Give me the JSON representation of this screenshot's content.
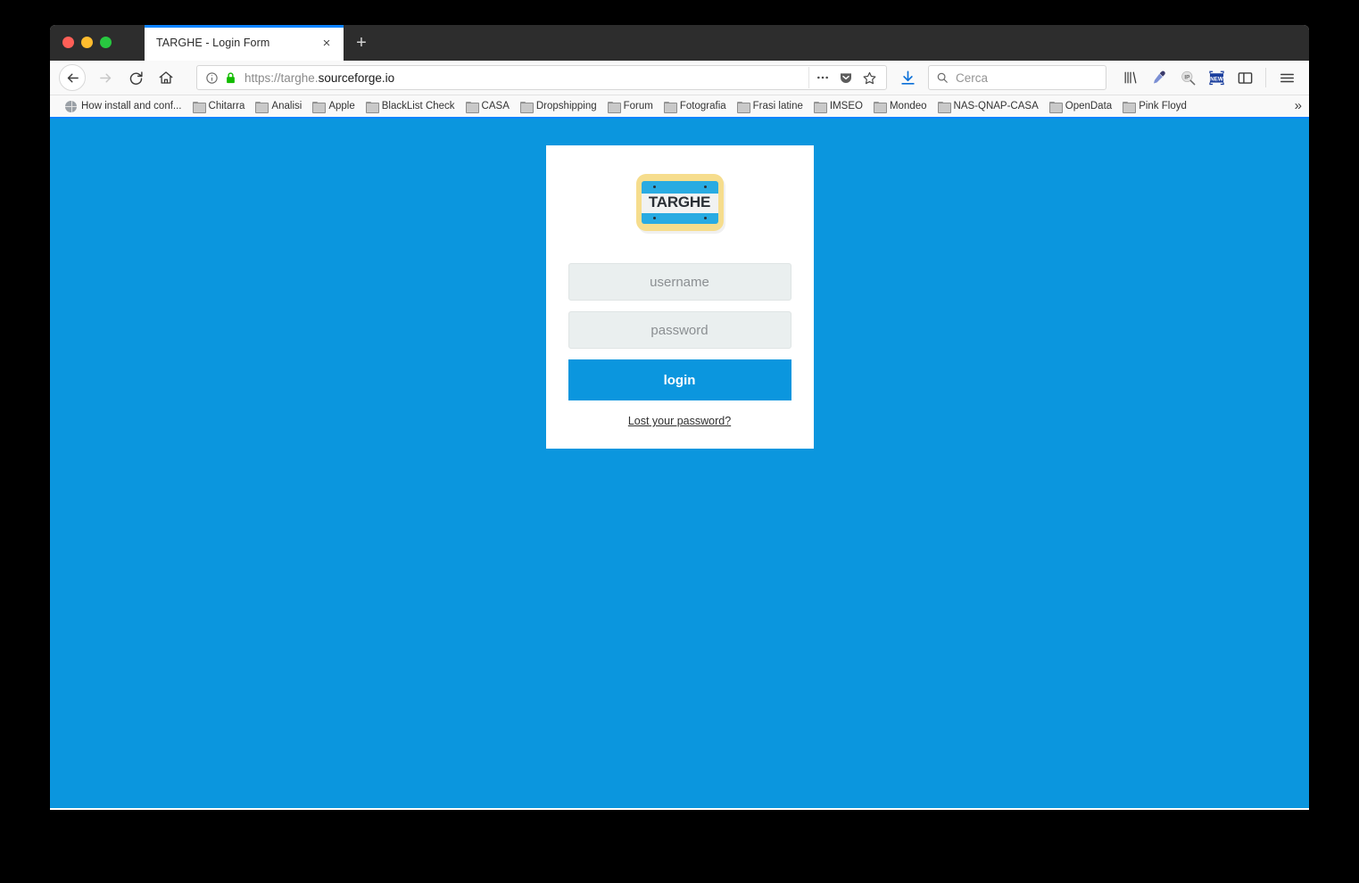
{
  "window": {
    "traffic_lights": [
      "close",
      "minimize",
      "zoom"
    ]
  },
  "tabs": {
    "active": {
      "title": "TARGHE - Login Form",
      "close_label": "×"
    },
    "new_tab_label": "+"
  },
  "toolbar": {
    "back_label": "←",
    "forward_label": "→",
    "reload_label": "⟳",
    "home_label": "⌂",
    "url": {
      "prefix": "https://targhe.",
      "domain": "sourceforge.io",
      "full": "https://targhe.sourceforge.io",
      "security": "secure-lock",
      "info_icon": "info-icon",
      "page_actions_label": "•••",
      "pocket_label": "pocket-icon",
      "bookmark_star_label": "☆"
    },
    "downloads_label": "downloads-icon",
    "search": {
      "placeholder": "Cerca",
      "icon": "search-icon"
    },
    "icons": [
      {
        "name": "library-icon",
        "label": "library"
      },
      {
        "name": "eyedropper-icon",
        "label": "eyedropper"
      },
      {
        "name": "ip-lookup-icon",
        "label": "IP"
      },
      {
        "name": "new-badge-icon",
        "label": "NEW"
      },
      {
        "name": "sidebar-icon",
        "label": "sidebar"
      }
    ],
    "menu_label": "≡"
  },
  "bookmarks": {
    "items": [
      {
        "label": "How install and conf...",
        "icon": "globe-icon"
      },
      {
        "label": "Chitarra",
        "icon": "folder-icon"
      },
      {
        "label": "Analisi",
        "icon": "folder-icon"
      },
      {
        "label": "Apple",
        "icon": "folder-icon"
      },
      {
        "label": "BlackList Check",
        "icon": "folder-icon"
      },
      {
        "label": "CASA",
        "icon": "folder-icon"
      },
      {
        "label": "Dropshipping",
        "icon": "folder-icon"
      },
      {
        "label": "Forum",
        "icon": "folder-icon"
      },
      {
        "label": "Fotografia",
        "icon": "folder-icon"
      },
      {
        "label": "Frasi latine",
        "icon": "folder-icon"
      },
      {
        "label": "IMSEO",
        "icon": "folder-icon"
      },
      {
        "label": "Mondeo",
        "icon": "folder-icon"
      },
      {
        "label": "NAS-QNAP-CASA",
        "icon": "folder-icon"
      },
      {
        "label": "OpenData",
        "icon": "folder-icon"
      },
      {
        "label": "Pink Floyd",
        "icon": "folder-icon"
      }
    ],
    "overflow_label": "»"
  },
  "page": {
    "background_color": "#0b96de",
    "logo": {
      "text": "TARGHE",
      "frame_color": "#f6dd8d",
      "plate_color": "#29ABE2",
      "band_color": "#f1f2f2",
      "alt": "license-plate-logo"
    },
    "form": {
      "username_placeholder": "username",
      "username_value": "",
      "password_placeholder": "password",
      "password_value": "",
      "submit_label": "login",
      "lost_password_label": "Lost your password?",
      "accent_color": "#0b96de"
    }
  }
}
